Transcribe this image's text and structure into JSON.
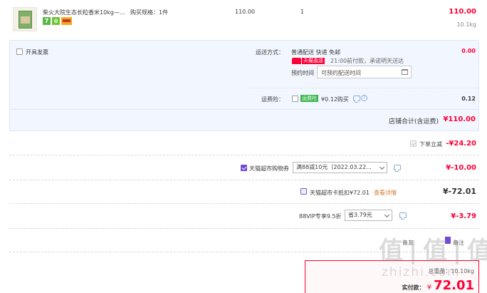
{
  "product": {
    "title": "柴火大院生态长粒香米10kg—...",
    "spec_label": "购买规格：",
    "spec_value": "1件",
    "unit_price": "110.00",
    "quantity": "1",
    "subtotal": "110.00",
    "weight": "10.1kg",
    "badge_seven": "7",
    "badge_green": "⊕"
  },
  "invoice": {
    "label": "开具发票"
  },
  "shipping": {
    "label": "运送方式：",
    "method": "普通配送 快递 免邮",
    "price": "0.00",
    "tmall_tag": "天猫直送",
    "delivery_note": "21:00前付款，承诺明天送达",
    "appointment_label": "预约时间",
    "appointment_placeholder": "可预约配送时间"
  },
  "insurance": {
    "label": "运费险：",
    "tag": "运费险",
    "desc": "¥0.12购买",
    "price": "0.12"
  },
  "shop_total": {
    "label": "店铺合计(含运费)",
    "value": "¥110.00"
  },
  "discounts": {
    "order_discount_label": "下单立减",
    "order_discount_value": "-¥24.20",
    "coupon_label": "天猫超市购物券",
    "coupon_select": "满88减10元（2022.03.22...",
    "coupon_value": "¥-10.00",
    "card_label": "天猫超市卡抵扣¥72.01",
    "card_link": "查看详情",
    "card_value": "¥-72.01",
    "vip_label": "88VIP专享9.5折",
    "vip_select": "省3.79元",
    "vip_value": "¥-3.79"
  },
  "partial_row": {
    "text_a": "备友",
    "text_b": "备注"
  },
  "summary": {
    "weight_label": "总重量：",
    "weight_value": "10.10kg",
    "pay_label": "实付款：",
    "pay_currency": "¥",
    "pay_value": "72.01"
  },
  "watermark": {
    "chars": "值 | 值 | 值",
    "url": "zhizhi.com"
  }
}
